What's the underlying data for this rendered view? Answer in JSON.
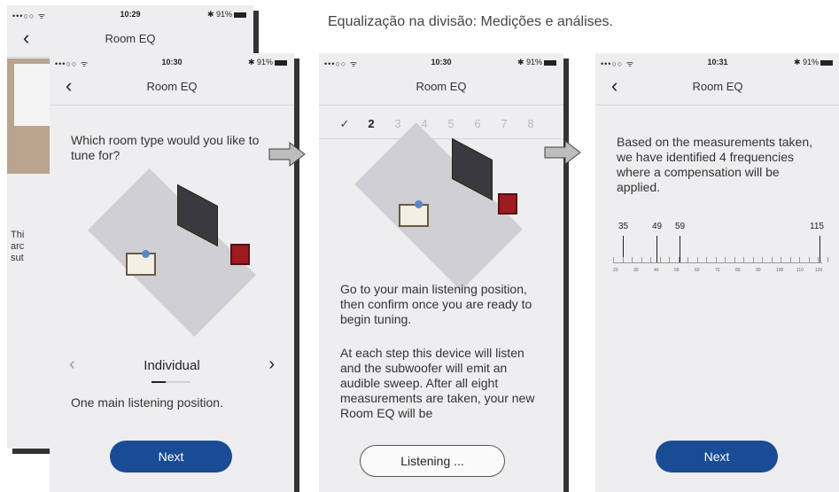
{
  "caption": "Equalização na divisão: Medições e análises.",
  "screens": [
    {
      "status": {
        "signal": "•••○○ ᯤ",
        "time": "10:29",
        "battery": "✱ 91%"
      },
      "nav": {
        "back": "‹",
        "title": "Room EQ"
      },
      "side_text": "Thi\narc\nsut"
    },
    {
      "status": {
        "signal": "•••○○ ᯤ",
        "time": "10:30",
        "battery": "✱ 91%"
      },
      "nav": {
        "back": "‹",
        "title": "Room EQ"
      },
      "question": "Which room type would you like to tune for?",
      "selector": {
        "prev": "‹",
        "value": "Individual",
        "next": "›"
      },
      "description": "One main listening position.",
      "primary_button": "Next"
    },
    {
      "status": {
        "signal": "•••○○ ᯤ",
        "time": "10:30",
        "battery": "✱ 91%"
      },
      "nav": {
        "title": "Room EQ"
      },
      "steps": [
        "✓",
        "2",
        "3",
        "4",
        "5",
        "6",
        "7",
        "8"
      ],
      "current_step": 2,
      "paragraph1": "Go to your main listening position, then confirm once you are ready to begin tuning.",
      "paragraph2": "At each step this device will listen and the subwoofer will emit an audible sweep. After all eight measurements are taken, your new Room EQ will be",
      "outline_button": "Listening ..."
    },
    {
      "status": {
        "signal": "•••○○ ᯤ",
        "time": "10:31",
        "battery": "✱ 91%"
      },
      "nav": {
        "back": "‹",
        "title": "Room EQ"
      },
      "result_text": "Based on the measurements taken, we have identified 4 frequencies where a compensation will be applied.",
      "frequencies": [
        "35",
        "49",
        "59",
        "115"
      ],
      "axis_ticks": [
        "20",
        "30",
        "40",
        "50",
        "60",
        "70",
        "80",
        "90",
        "100",
        "110",
        "120"
      ],
      "primary_button": "Next"
    }
  ],
  "colors": {
    "primary_button": "#1a4c96",
    "subwoofer": "#9e1b22",
    "screen_bg": "#eeeef1"
  },
  "icons": {
    "flow_arrow": "arrow-right-icon"
  }
}
